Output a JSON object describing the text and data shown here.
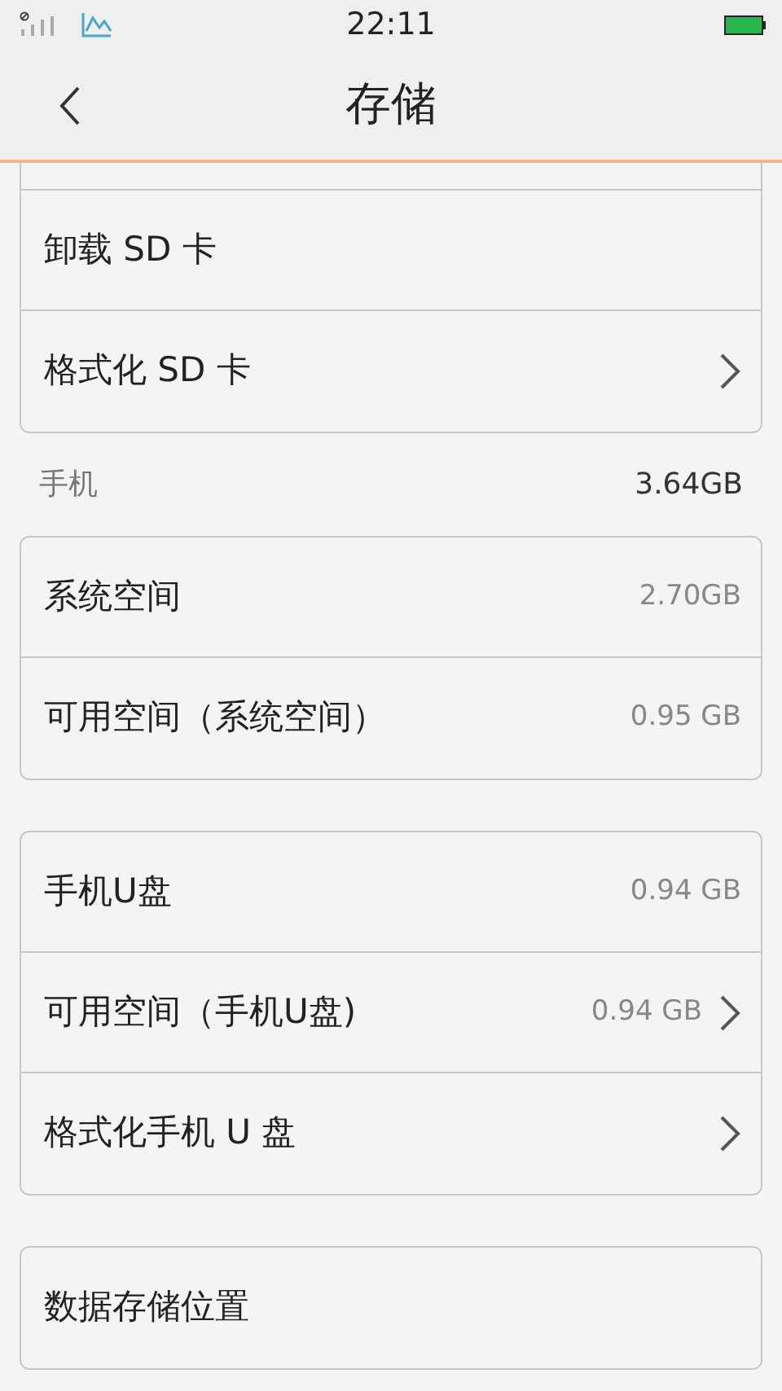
{
  "status_bar": {
    "time": "22:11"
  },
  "header": {
    "title": "存储"
  },
  "groups": [
    {
      "rows": [
        {
          "label": "卸载 SD 卡",
          "chevron": false
        },
        {
          "label": "格式化 SD 卡",
          "chevron": true
        }
      ]
    },
    {
      "section": {
        "label": "手机",
        "value": "3.64GB"
      },
      "rows": [
        {
          "label": "系统空间",
          "value": "2.70GB",
          "chevron": false
        },
        {
          "label": "可用空间（系统空间）",
          "value": "0.95 GB",
          "chevron": false
        }
      ]
    },
    {
      "rows": [
        {
          "label": "手机U盘",
          "value": "0.94 GB",
          "chevron": false
        },
        {
          "label": "可用空间（手机U盘)",
          "value": "0.94 GB",
          "chevron": true
        },
        {
          "label": "格式化手机 U 盘",
          "chevron": true
        }
      ]
    },
    {
      "rows": [
        {
          "label": "数据存储位置",
          "chevron": false
        }
      ]
    }
  ]
}
